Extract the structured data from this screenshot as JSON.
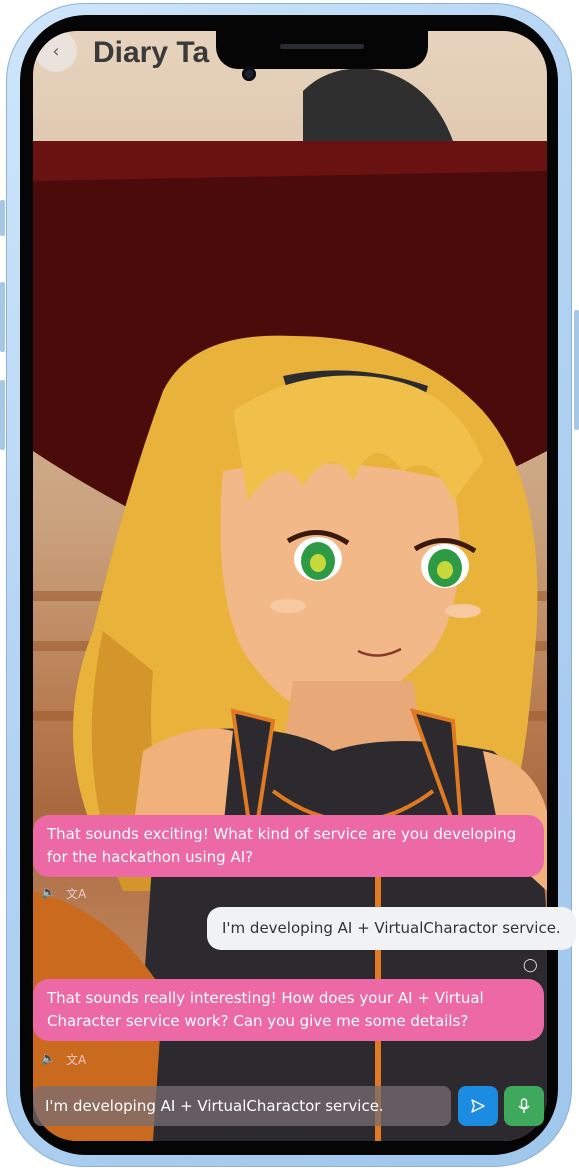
{
  "header": {
    "title": "Diary Ta",
    "back_icon": "chevron-left-icon"
  },
  "chat": {
    "messages": [
      {
        "role": "assistant",
        "text": "That sounds exciting! What kind of service are you developing for the hackathon using AI?",
        "actions": [
          "speaker-icon",
          "translate-icon"
        ]
      },
      {
        "role": "user",
        "text": "I'm developing AI + VirtualCharactor service.",
        "actions": [
          "lightbulb-icon"
        ]
      },
      {
        "role": "assistant",
        "text": "That sounds really interesting! How does your AI + Virtual Character service work? Can you give me some details?",
        "actions": [
          "speaker-icon",
          "translate-icon"
        ]
      }
    ]
  },
  "composer": {
    "value": "I'm developing AI + VirtualCharactor service.",
    "send_icon": "send-icon",
    "mic_icon": "microphone-icon"
  },
  "colors": {
    "assistant_bubble": "#ec69a6",
    "user_bubble": "#f1f2f4",
    "send_button": "#1c8ce3",
    "mic_button": "#3ea95c",
    "phone_frame": "#b4d4f3"
  }
}
